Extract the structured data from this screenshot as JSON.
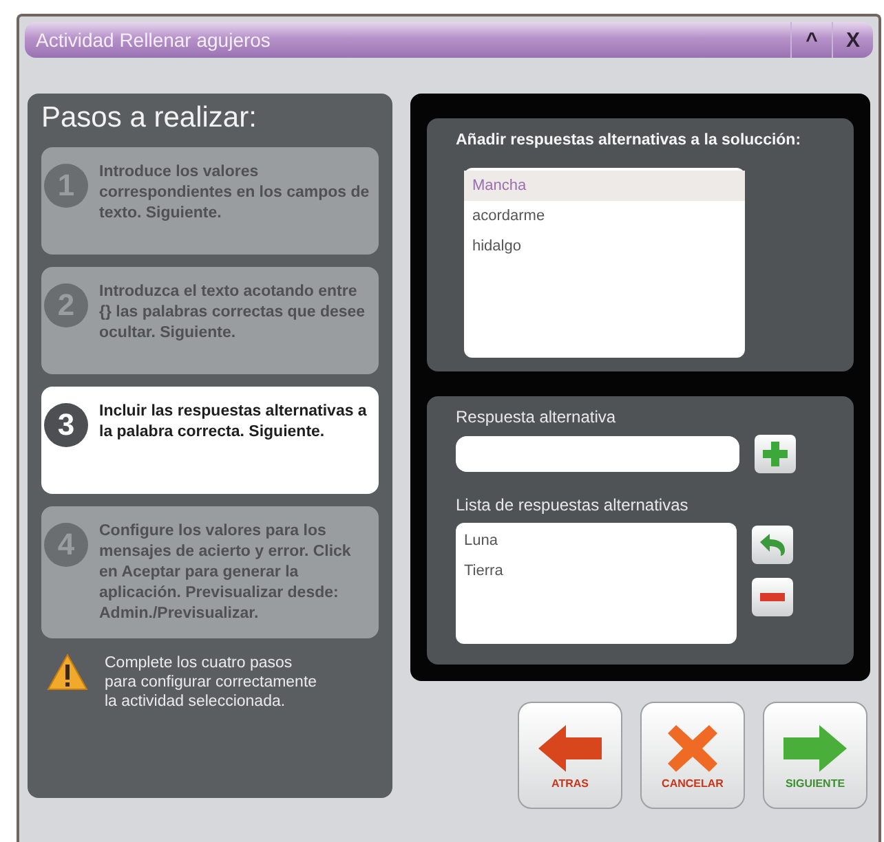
{
  "window": {
    "title": "Actividad Rellenar agujeros",
    "controls": [
      "^",
      "X"
    ]
  },
  "steps_panel": {
    "heading": "Pasos a realizar:",
    "steps": [
      {
        "number": "1",
        "text": "Introduce los valores correspondientes en los campos de texto. Siguiente.",
        "selected": false
      },
      {
        "number": "2",
        "text": "Introduzca el texto acotando entre {} las palabras correctas que desee ocultar. Siguiente.",
        "selected": false
      },
      {
        "number": "3",
        "text": "Incluir las respuestas alternativas a la palabra correcta. Siguiente.",
        "selected": true
      },
      {
        "number": "4",
        "text": "Configure los valores para los mensajes de acierto y error. Click en Aceptar para generar la aplicación. Previsualizar desde: Admin./Previsualizar.",
        "selected": false
      }
    ],
    "warning": "Complete los cuatro pasos para configurar correctamente la actividad seleccionada."
  },
  "solution": {
    "heading": "Añadir respuestas alternativas a la solucción:",
    "words": [
      {
        "text": "Mancha",
        "selected": true
      },
      {
        "text": "acordarme",
        "selected": false
      },
      {
        "text": "hidalgo",
        "selected": false
      }
    ]
  },
  "alternative": {
    "label": "Respuesta alternativa",
    "list_label": "Lista de respuestas alternativas",
    "answers": [
      "Luna",
      "Tierra"
    ]
  },
  "buttons": [
    {
      "kind": "back",
      "label": "ATRAS"
    },
    {
      "kind": "cancel",
      "label": "CANCELAR"
    },
    {
      "kind": "next",
      "label": "SIGUIENTE"
    }
  ]
}
